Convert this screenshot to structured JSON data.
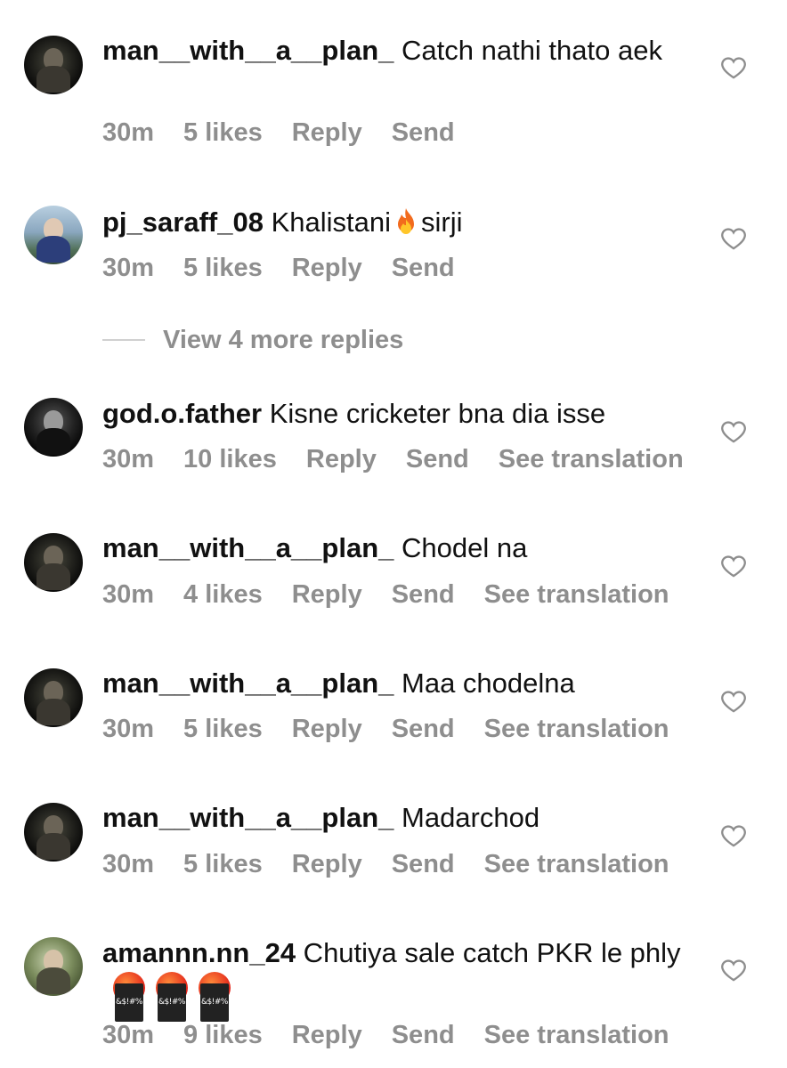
{
  "comments": [
    {
      "username": "man__with__a__plan_",
      "text": " Catch nathi thato aek",
      "time": "30m",
      "likes": "5 likes",
      "reply": "Reply",
      "send": "Send",
      "translation": ""
    },
    {
      "username": "pj_saraff_08",
      "text_before": " Khalistani",
      "text_after": "sirji",
      "time": "30m",
      "likes": "5 likes",
      "reply": "Reply",
      "send": "Send"
    },
    {
      "username": "god.o.father",
      "text": " Kisne cricketer bna dia isse",
      "time": "30m",
      "likes": "10 likes",
      "reply": "Reply",
      "send": "Send",
      "translation": "See translation"
    },
    {
      "username": "man__with__a__plan_",
      "text": " Chodel na",
      "time": "30m",
      "likes": "4 likes",
      "reply": "Reply",
      "send": "Send",
      "translation": "See translation"
    },
    {
      "username": "man__with__a__plan_",
      "text": " Maa chodelna",
      "time": "30m",
      "likes": "5 likes",
      "reply": "Reply",
      "send": "Send",
      "translation": "See translation"
    },
    {
      "username": "man__with__a__plan_",
      "text": " Madarchod",
      "time": "30m",
      "likes": "5 likes",
      "reply": "Reply",
      "send": "Send",
      "translation": "See translation"
    },
    {
      "username": "amannn.nn_24",
      "text": " Chutiya sale catch PKR le phly",
      "time": "30m",
      "likes": "9 likes",
      "reply": "Reply",
      "send": "Send",
      "translation": "See translation"
    }
  ],
  "view_more": "View 4 more replies",
  "icons": {
    "like": "heart-outline-icon",
    "fire": "fire-emoji-icon",
    "cursing": "cursing-face-emoji-icon"
  }
}
